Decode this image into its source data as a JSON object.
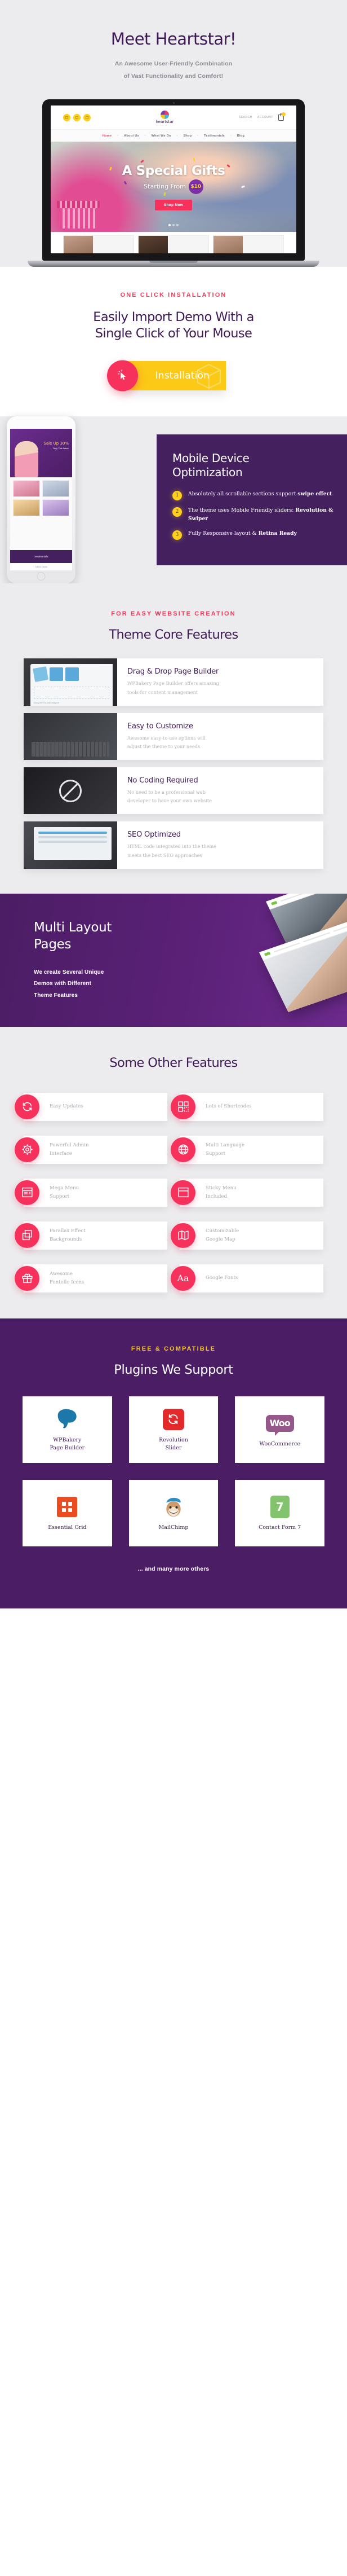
{
  "hero": {
    "title": "Meet Heartstar!",
    "subtitle_line1": "An Awesome User-Friendly Combination",
    "subtitle_line2": "of Vast Functionality  and Comfort!",
    "mock": {
      "logo_text": "heartstar",
      "account_label": "ACCOUNT",
      "search_label": "SEARCH",
      "nav": [
        "Home",
        "About Us",
        "What We Do",
        "Shop",
        "Testimonials",
        "Blog"
      ],
      "slide_title": "A Special Gifts",
      "slide_sub": "Starting From",
      "slide_price": "$10",
      "slide_price_cents": "00",
      "slide_button": "Shop Now"
    }
  },
  "oneclick": {
    "eyebrow": "ONE CLICK INSTALLATION",
    "title_line1": "Easily Import Demo With a",
    "title_line2": "Single Click of Your Mouse",
    "button_label": "Installation"
  },
  "mobile": {
    "title_line1": "Mobile Device",
    "title_line2": "Optimization",
    "items": [
      {
        "num": "1",
        "text": "Absolutely all scrollable  sections support ",
        "bold": "swipe effect"
      },
      {
        "num": "2",
        "text": "The theme uses Mobile Friendly sliders: ",
        "bold": "Revolution & Swiper"
      },
      {
        "num": "3",
        "text": "Fully Responsive layout & ",
        "bold": "Retina Ready"
      }
    ],
    "phone": {
      "promo_title": "Sale Up 30%",
      "promo_sub": "Only This Week",
      "band_text": "Testimonials",
      "footer_text": "Latest News"
    }
  },
  "core": {
    "eyebrow": "FOR EASY WEBSITE CREATION",
    "title": "Theme Core Features",
    "features": [
      {
        "title": "Drag & Drop Page Builder",
        "desc_line1": "WPBakery Page Builder offers amazing",
        "desc_line2": "tools for content management",
        "image_caption": "Drag here to add widgets"
      },
      {
        "title": "Easy to Customize",
        "desc_line1": "Awesome easy-to-use options will",
        "desc_line2": "adjust the theme to your needs",
        "image_caption": ""
      },
      {
        "title": "No Coding Required",
        "desc_line1": "No need to be a professional web",
        "desc_line2": "developer to have your own website",
        "image_caption": ""
      },
      {
        "title": "SEO Optimized",
        "desc_line1": "HTML code integrated into the theme",
        "desc_line2": "meets the best SEO approaches",
        "image_caption": ""
      }
    ]
  },
  "multi": {
    "title_line1": "Multi Layout",
    "title_line2": "Pages",
    "desc_line1": "We create Several Unique",
    "desc_line2": "Demos with Different",
    "desc_line3": "Theme Features"
  },
  "other": {
    "title": "Some Other Features",
    "items": [
      {
        "label_line1": "Easy Updates",
        "label_line2": "",
        "icon": "refresh-icon"
      },
      {
        "label_line1": "Lots of Shortcodes",
        "label_line2": "",
        "icon": "grid-blocks-icon"
      },
      {
        "label_line1": "Powerful Admin",
        "label_line2": "Interface",
        "icon": "gear-icon"
      },
      {
        "label_line1": "Multi Language",
        "label_line2": "Support",
        "icon": "globe-icon"
      },
      {
        "label_line1": "Mega Menu",
        "label_line2": "Support",
        "icon": "mega-menu-icon"
      },
      {
        "label_line1": "Sticky Menu",
        "label_line2": "Included",
        "icon": "sticky-menu-icon"
      },
      {
        "label_line1": "Parallax Effect",
        "label_line2": "Backgrounds",
        "icon": "layers-icon"
      },
      {
        "label_line1": "Customizable",
        "label_line2": "Google Map",
        "icon": "map-icon"
      },
      {
        "label_line1": "Awesome",
        "label_line2": "Fontello Icons",
        "icon": "gift-icon"
      },
      {
        "label_line1": "Google Fonts",
        "label_line2": "",
        "icon": "font-aa-icon"
      }
    ]
  },
  "plugins": {
    "eyebrow": "FREE & COMPATIBLE",
    "title": "Plugins We Support",
    "items": [
      {
        "name_line1": "WPBakery",
        "name_line2": "Page Builder",
        "logo": "wpbakery-logo"
      },
      {
        "name_line1": "Revolution",
        "name_line2": "Slider",
        "logo": "revolution-slider-logo"
      },
      {
        "name_line1": "WooCommerce",
        "name_line2": "",
        "logo": "woocommerce-logo"
      },
      {
        "name_line1": "Essential Grid",
        "name_line2": "",
        "logo": "essential-grid-logo"
      },
      {
        "name_line1": "MailChimp",
        "name_line2": "",
        "logo": "mailchimp-logo"
      },
      {
        "name_line1": "Contact Form 7",
        "name_line2": "",
        "logo": "contact-form-7-logo"
      }
    ],
    "footer_note": "... and many more others"
  },
  "colors": {
    "purple": "#4b1d64",
    "purple_dark": "#3e1a55",
    "pink": "#f6325c",
    "yellow": "#fbc916",
    "grey_bg": "#ecebed",
    "muted_text": "#b4b4bb"
  }
}
